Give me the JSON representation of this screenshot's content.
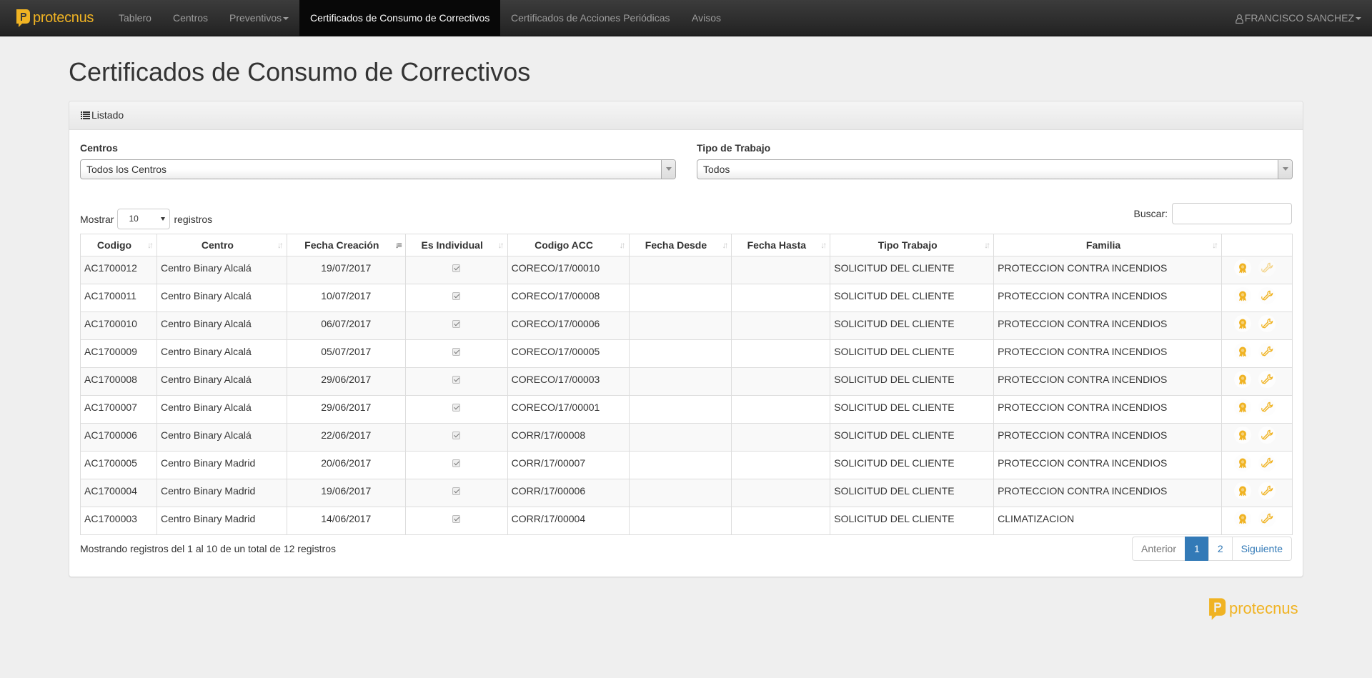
{
  "brand": {
    "name": "protecnus"
  },
  "nav": {
    "items": [
      {
        "label": "Tablero"
      },
      {
        "label": "Centros"
      },
      {
        "label": "Preventivos"
      },
      {
        "label": "Certificados de Consumo de Correctivos"
      },
      {
        "label": "Certificados de Acciones Periódicas"
      },
      {
        "label": "Avisos"
      }
    ],
    "user": "FRANCISCO SANCHEZ"
  },
  "page": {
    "title": "Certificados de Consumo de Correctivos"
  },
  "panel": {
    "heading": "Listado"
  },
  "filters": {
    "centros": {
      "label": "Centros",
      "value": "Todos los Centros"
    },
    "tipo": {
      "label": "Tipo de Trabajo",
      "value": "Todos"
    }
  },
  "length": {
    "prefix": "Mostrar",
    "value": "10",
    "suffix": "registros"
  },
  "search": {
    "label": "Buscar:",
    "value": ""
  },
  "table": {
    "columns": [
      "Codigo",
      "Centro",
      "Fecha Creación",
      "Es Individual",
      "Codigo ACC",
      "Fecha Desde",
      "Fecha Hasta",
      "Tipo Trabajo",
      "Familia",
      ""
    ],
    "rows": [
      {
        "codigo": "AC1700012",
        "centro": "Centro Binary Alcalá",
        "fecha": "19/07/2017",
        "acc": "CORECO/17/00010",
        "desde": "",
        "hasta": "",
        "tipo": "SOLICITUD DEL CLIENTE",
        "familia": "PROTECCION CONTRA INCENDIOS"
      },
      {
        "codigo": "AC1700011",
        "centro": "Centro Binary Alcalá",
        "fecha": "10/07/2017",
        "acc": "CORECO/17/00008",
        "desde": "",
        "hasta": "",
        "tipo": "SOLICITUD DEL CLIENTE",
        "familia": "PROTECCION CONTRA INCENDIOS"
      },
      {
        "codigo": "AC1700010",
        "centro": "Centro Binary Alcalá",
        "fecha": "06/07/2017",
        "acc": "CORECO/17/00006",
        "desde": "",
        "hasta": "",
        "tipo": "SOLICITUD DEL CLIENTE",
        "familia": "PROTECCION CONTRA INCENDIOS"
      },
      {
        "codigo": "AC1700009",
        "centro": "Centro Binary Alcalá",
        "fecha": "05/07/2017",
        "acc": "CORECO/17/00005",
        "desde": "",
        "hasta": "",
        "tipo": "SOLICITUD DEL CLIENTE",
        "familia": "PROTECCION CONTRA INCENDIOS"
      },
      {
        "codigo": "AC1700008",
        "centro": "Centro Binary Alcalá",
        "fecha": "29/06/2017",
        "acc": "CORECO/17/00003",
        "desde": "",
        "hasta": "",
        "tipo": "SOLICITUD DEL CLIENTE",
        "familia": "PROTECCION CONTRA INCENDIOS"
      },
      {
        "codigo": "AC1700007",
        "centro": "Centro Binary Alcalá",
        "fecha": "29/06/2017",
        "acc": "CORECO/17/00001",
        "desde": "",
        "hasta": "",
        "tipo": "SOLICITUD DEL CLIENTE",
        "familia": "PROTECCION CONTRA INCENDIOS"
      },
      {
        "codigo": "AC1700006",
        "centro": "Centro Binary Alcalá",
        "fecha": "22/06/2017",
        "acc": "CORR/17/00008",
        "desde": "",
        "hasta": "",
        "tipo": "SOLICITUD DEL CLIENTE",
        "familia": "PROTECCION CONTRA INCENDIOS"
      },
      {
        "codigo": "AC1700005",
        "centro": "Centro Binary Madrid",
        "fecha": "20/06/2017",
        "acc": "CORR/17/00007",
        "desde": "",
        "hasta": "",
        "tipo": "SOLICITUD DEL CLIENTE",
        "familia": "PROTECCION CONTRA INCENDIOS"
      },
      {
        "codigo": "AC1700004",
        "centro": "Centro Binary Madrid",
        "fecha": "19/06/2017",
        "acc": "CORR/17/00006",
        "desde": "",
        "hasta": "",
        "tipo": "SOLICITUD DEL CLIENTE",
        "familia": "PROTECCION CONTRA INCENDIOS"
      },
      {
        "codigo": "AC1700003",
        "centro": "Centro Binary Madrid",
        "fecha": "14/06/2017",
        "acc": "CORR/17/00004",
        "desde": "",
        "hasta": "",
        "tipo": "SOLICITUD DEL CLIENTE",
        "familia": "CLIMATIZACION"
      }
    ]
  },
  "info": "Mostrando registros del 1 al 10 de un total de 12 registros",
  "pagination": {
    "prev": "Anterior",
    "pages": [
      "1",
      "2"
    ],
    "next": "Siguiente"
  },
  "colors": {
    "brand": "#f0b323",
    "primary": "#337ab7",
    "navbar": "#222222"
  }
}
